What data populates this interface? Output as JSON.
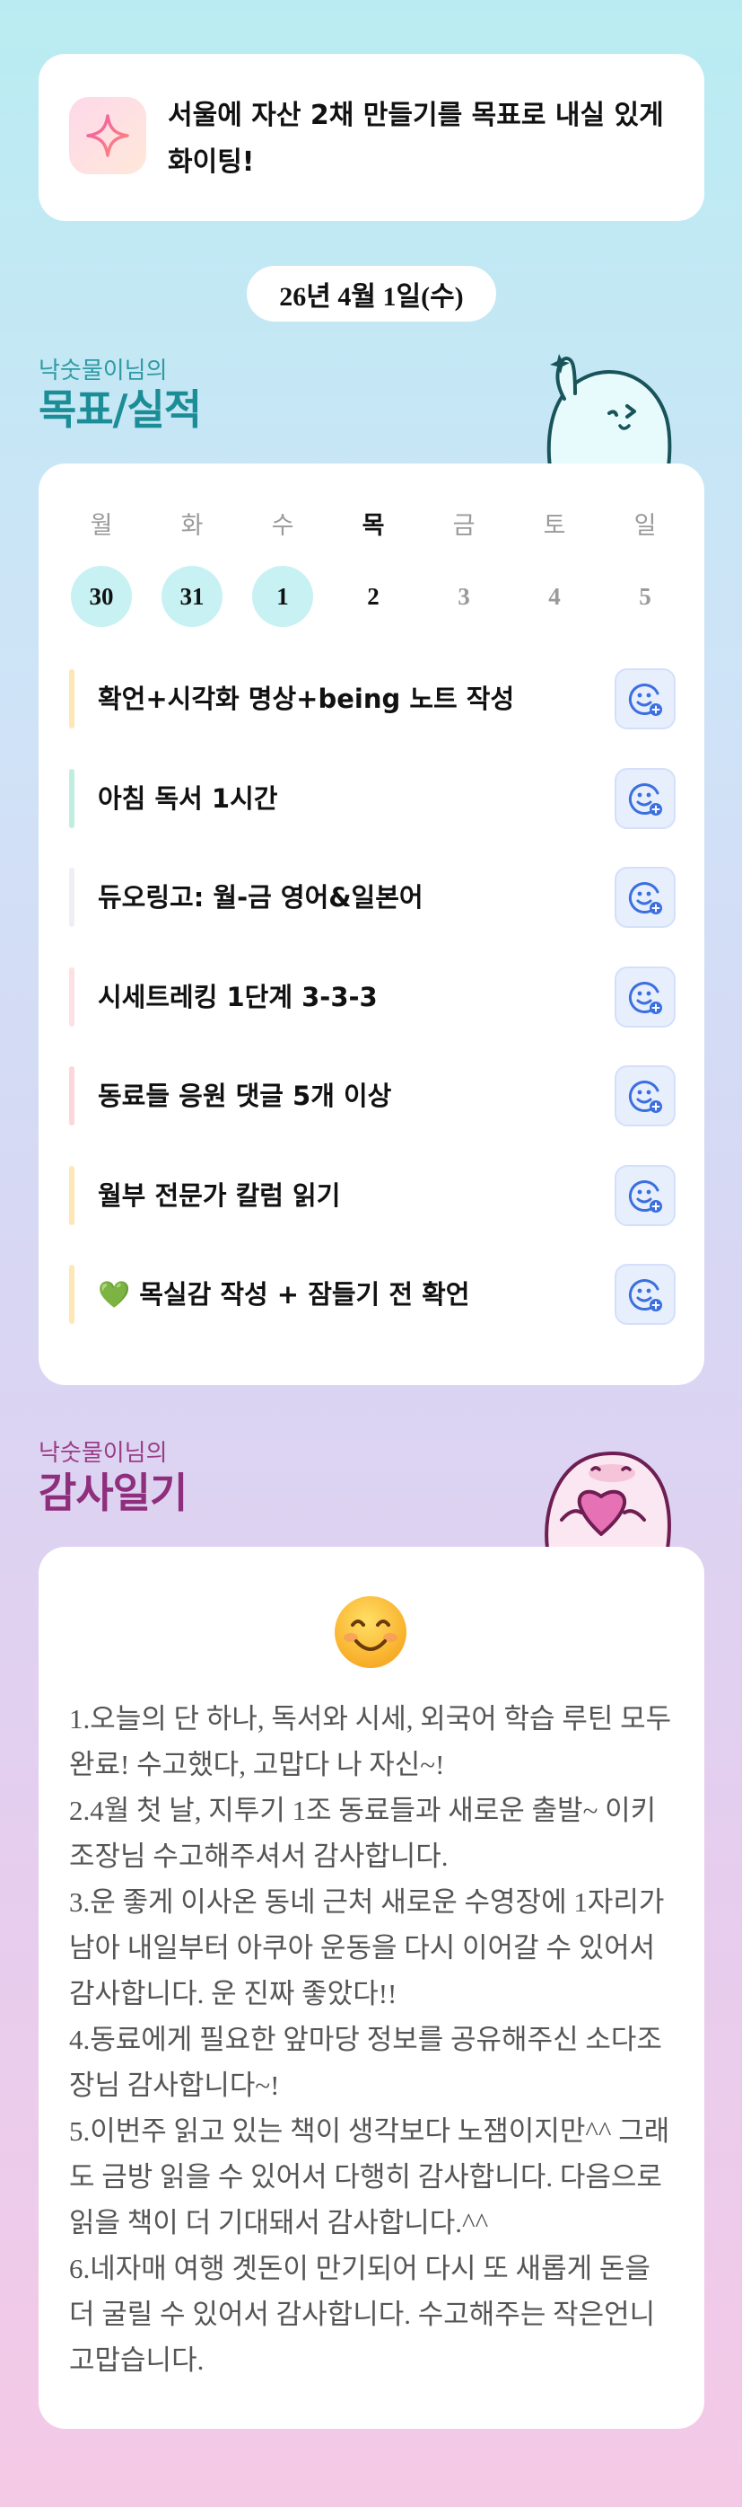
{
  "goal": {
    "text": "서울에 자산 2채 만들기를 목표로 내실 있게 화이팅!",
    "icon": "sparkle-icon"
  },
  "date_label": "26년 4월 1일(수)",
  "records_section": {
    "subtitle": "낙숫물이님의",
    "title": "목표/실적"
  },
  "week": [
    {
      "day": "월",
      "date": "30",
      "state": "done"
    },
    {
      "day": "화",
      "date": "31",
      "state": "done"
    },
    {
      "day": "수",
      "date": "1",
      "state": "done"
    },
    {
      "day": "목",
      "date": "2",
      "state": "today"
    },
    {
      "day": "금",
      "date": "3",
      "state": "future"
    },
    {
      "day": "토",
      "date": "4",
      "state": "future"
    },
    {
      "day": "일",
      "date": "5",
      "state": "future"
    }
  ],
  "tasks": [
    {
      "label": "확언+시각화 명상+being 노트 작성",
      "color": "#fde7b6"
    },
    {
      "label": "아침 독서 1시간",
      "color": "#bfeee0"
    },
    {
      "label": "듀오링고: 월-금 영어&일본어",
      "color": "#eeeef4"
    },
    {
      "label": "시세트레킹 1단계 3-3-3",
      "color": "#fde0e3"
    },
    {
      "label": "동료들 응원 댓글 5개 이상",
      "color": "#fcd6da"
    },
    {
      "label": "월부 전문가 칼럼 읽기",
      "color": "#fde7b6"
    },
    {
      "label": "💚 목실감 작성 + 잠들기 전 확언",
      "color": "#fde7b6"
    }
  ],
  "task_button_icon": "smile-add-icon",
  "gratitude_section": {
    "subtitle": "낙숫물이님의",
    "title": "감사일기",
    "emoji": "smiling-face-icon",
    "entries": [
      "1.오늘의 단 하나, 독서와 시세, 외국어 학습 루틴 모두 완료! 수고했다, 고맙다 나 자신~!",
      "2.4월 첫 날, 지투기 1조 동료들과 새로운 출발~ 이키 조장님 수고해주셔서 감사합니다.",
      "3.운 좋게 이사온 동네 근처 새로운 수영장에 1자리가 남아 내일부터 아쿠아 운동을 다시 이어갈 수 있어서 감사합니다. 운 진짜 좋았다!!",
      "4.동료에게 필요한 앞마당 정보를 공유해주신 소다조장님 감사합니다~!",
      "5.이번주 읽고 있는 책이 생각보다 노잼이지만^^ 그래도 금방 읽을 수 있어서 다행히 감사합니다. 다음으로 읽을 책이 더 기대돼서 감사합니다.^^",
      "6.네자매 여행 곗돈이 만기되어 다시 또 새롭게 돈을 더 굴릴 수 있어서 감사합니다. 수고해주는 작은언니 고맙습니다."
    ]
  },
  "colors": {
    "accent_teal": "#1a8d96",
    "accent_plum": "#8f2e7c",
    "done_day_bg": "#c7f1f3",
    "button_icon": "#3b6fe0"
  }
}
